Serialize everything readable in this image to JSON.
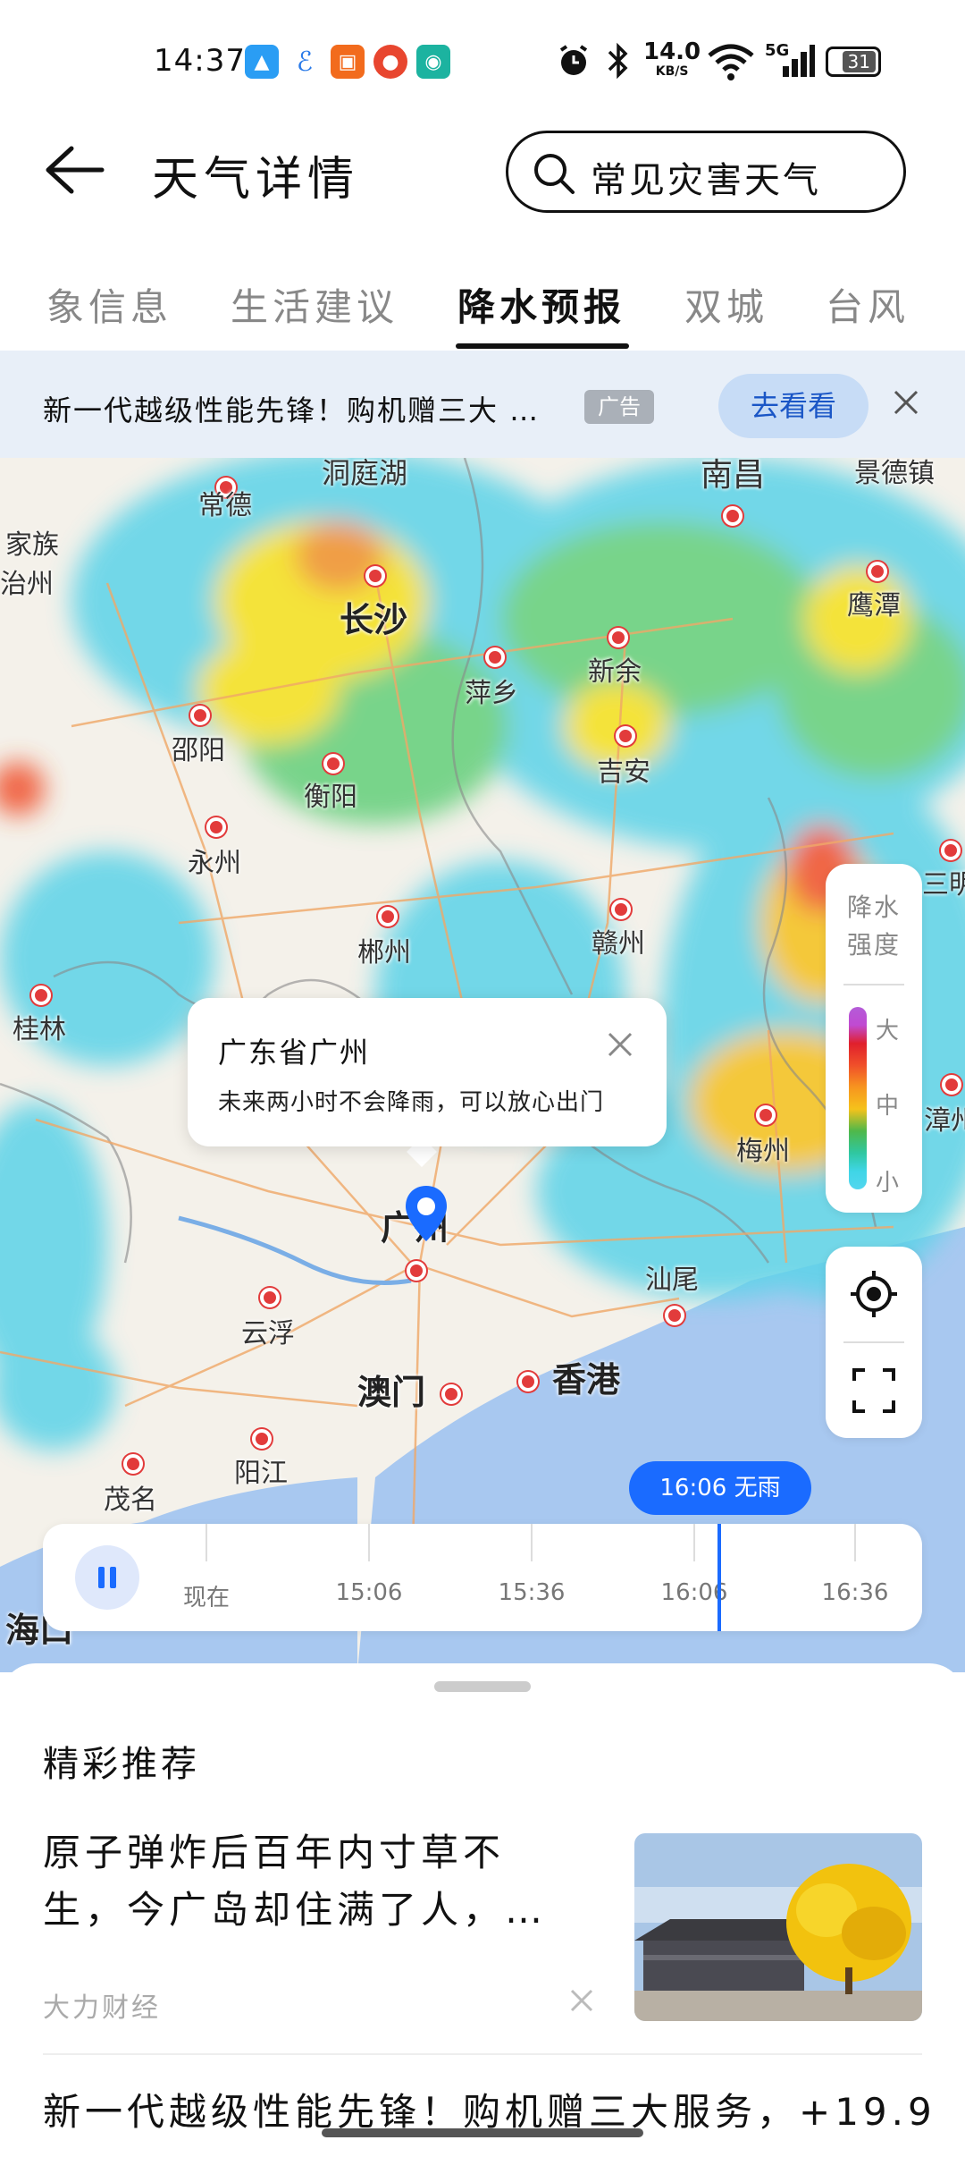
{
  "status_bar": {
    "time": "14:37",
    "network_speed": "14.0",
    "network_unit": "KB/S",
    "signal_label": "5G",
    "battery": "31"
  },
  "header": {
    "title": "天气详情",
    "back_icon": "arrow-left-icon",
    "search": {
      "text": "常见灾害天气",
      "icon": "search-icon"
    }
  },
  "tabs": [
    {
      "label": "象信息",
      "active": false
    },
    {
      "label": "生活建议",
      "active": false
    },
    {
      "label": "降水预报",
      "active": true
    },
    {
      "label": "双城",
      "active": false
    },
    {
      "label": "台风",
      "active": false
    }
  ],
  "ad_banner": {
    "text": "新一代越级性能先锋！购机赠三大 …",
    "badge": "广告",
    "button": "去看看"
  },
  "map": {
    "cities": [
      "常德",
      "洞庭湖",
      "南昌",
      "景德镇",
      "家族",
      "治州",
      "长沙",
      "鹰潭",
      "萍乡",
      "新余",
      "邵阳",
      "吉安",
      "衡阳",
      "永州",
      "三明",
      "郴州",
      "赣州",
      "桂林",
      "梅州",
      "漳州",
      "广州",
      "汕尾",
      "云浮",
      "澳门",
      "香港",
      "阳江",
      "茂名",
      "海口"
    ],
    "popup": {
      "title": "广东省广州",
      "text": "未来两小时不会降雨，可以放心出门"
    },
    "legend": {
      "title_line1": "降水",
      "title_line2": "强度",
      "high": "大",
      "mid": "中",
      "low": "小"
    }
  },
  "timeline": {
    "badge": "16:06 无雨",
    "labels": [
      "现在",
      "15:06",
      "15:36",
      "16:06",
      "16:36"
    ],
    "current_fraction": 0.73
  },
  "feed": {
    "section_title": "精彩推荐",
    "articles": [
      {
        "title": "原子弹炸后百年内寸草不生，今广岛却住满了人，…",
        "source": "大力财经"
      },
      {
        "title": "新一代越级性能先锋！购机赠三大服务，+19.9"
      }
    ]
  },
  "colors": {
    "accent": "#1a6bff",
    "ad_bg": "#e8eff8",
    "water": "#a8c8f0",
    "radar_light": "#3fd5e6",
    "radar_mid": "#f5e11c",
    "radar_heavy": "#f0502a"
  }
}
